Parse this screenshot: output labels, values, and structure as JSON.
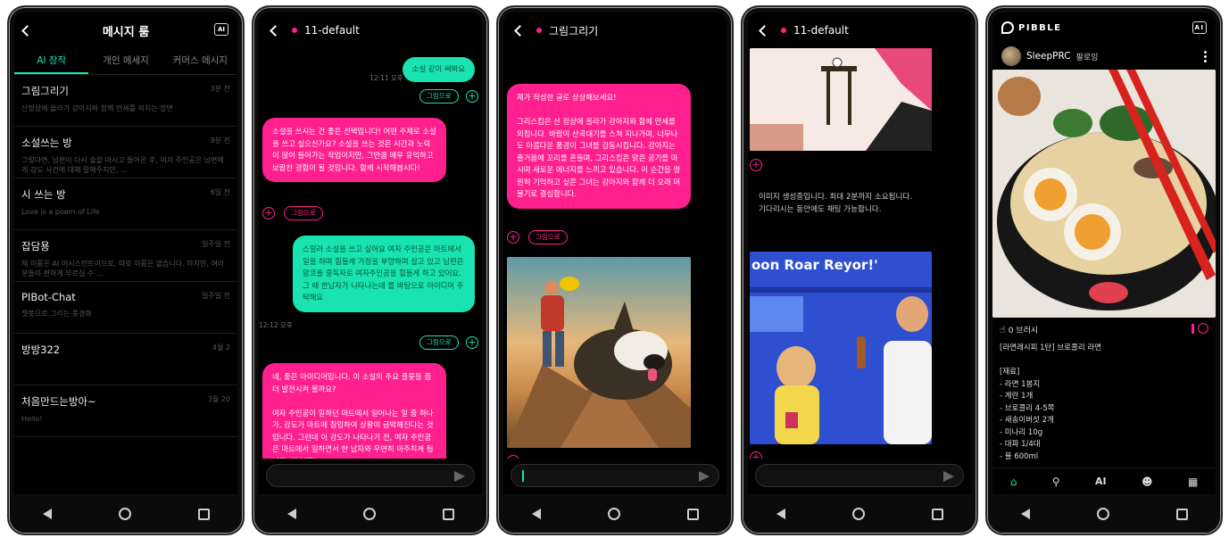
{
  "phone1": {
    "title": "메시지 룸",
    "ai_badge": "AI",
    "tabs": [
      "AI 창작",
      "개인 메세지",
      "커머스 메시지"
    ],
    "rooms": [
      {
        "name": "그림그리기",
        "preview": "산정상에 올라가 강아지와 함께 만세를 외치는 장면",
        "time": "3분 전"
      },
      {
        "name": "소설쓰는 방",
        "preview": "그렇다면, 남편이 다시 술을 마시고 들어온 후, 여자 주인공은 남편에게 강도 사건에 대해 말해주지만, ...",
        "time": "9분 전"
      },
      {
        "name": "시 쓰는 방",
        "preview": "Love is a poem of Life",
        "time": "6일 전"
      },
      {
        "name": "잡담용",
        "preview": "제 이름은 AI 어시스턴트이므로, 따로 이름은 없습니다. 하지만, 여러분들이 편하게 부르실 수 ...",
        "time": "일주일 전"
      },
      {
        "name": "PIBot-Chat",
        "preview": "챗봇으로 그리는 풍경화",
        "time": "일주일 전"
      },
      {
        "name": "방방322",
        "preview": "",
        "time": "4월 2"
      },
      {
        "name": "처음만드는방아~",
        "preview": "Hello!",
        "time": "3월 20"
      }
    ]
  },
  "phone2": {
    "title": "11-default",
    "msg1": "소설 같이 써봐요",
    "time1": "12:11 오후",
    "btn_image": "그림으로",
    "reply1": "소설을 쓰시는 건 좋은 선택입니다! 어떤 주제로 소설을 쓰고 싶으신가요? 소설을 쓰는 것은 시간과 노력이 많이 들어가는 작업이지만, 그만큼 매우 유익하고 보람찬 경험이 될 것입니다. 함께 시작해봅시다!",
    "msg2": "스릴러 소설을 쓰고 싶어요  여자 주인공은 마트에서 일을 하며 힘들게 가정을 부양하며 살고 있고  남편은 알코올 중독자로 여자주인공을 힘들게 하고 있어요. 그 때 한남자가 나타나는데  를 바탕으로 아이디어 주탁해요",
    "time2": "12:12 오후",
    "reply2": "네, 좋은 아이디어입니다. 이 소설의 주요 플롯을 좀 더 발전시켜 볼까요?\n\n여자 주인공이 일하던 마트에서 일어나는 일 중 하나가, 강도가 마트에 침입하여 상황이 급박해진다는 것입니다. 그런데 이 강도가 나타나기 전, 여자 주인공은 마트에서 일하면서 한 남자와 우연히 마주치게 됩니다. 이 남자는"
  },
  "phone3": {
    "title": "그림그리기",
    "reply": "제가 작성한 글로 상상해보세요!\n\n그리스킴은 산 정상에 올라가 강아지와 함께 만세를 외칩니다. 바람이 산곡대기를 스쳐 지나가며, 너무나도 아름다운 풍경이 그녀를 감동시킵니다. 강아지는 즐거움에 꼬리를 흔들며, 그리스킴은 맑은 공기를 마시며 새로운 에너지를 느끼고 있습니다. 이 순간을 영원히 기억하고 싶은 그녀는 강아지와 함께 더 오래 머물기로 결심합니다.",
    "btn_image": "그림으로"
  },
  "phone4": {
    "title": "11-default",
    "loading": "이미지 생성중입니다. 최대 2분까지 소요됩니다. 기다리시는 동안에도 채팅 가능합니다.",
    "poster_title": "oon Roar Reyor!'"
  },
  "phone5": {
    "brand": "PIBBLE",
    "ai_badge": "AI",
    "username": "SleepPRC",
    "follow": "팔로잉",
    "likes": "0 브러시",
    "post": "[라면레시피 1탄] 브로콜리 라면\n\n[재료]\n- 라면 1봉지\n- 계란 1개\n- 브로콜리 4-5쪽\n- 새송이버섯 2개\n- 미나리 10g\n- 대파 1/4대\n- 물 600ml",
    "nav_ai": "AI"
  }
}
